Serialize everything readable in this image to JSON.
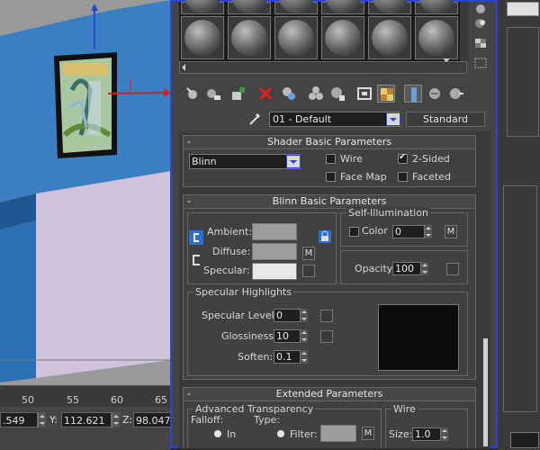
{
  "viewport": {
    "timeline_ticks": [
      "50",
      "55",
      "60",
      "65"
    ],
    "coords": {
      "x_value": ".549",
      "y_label": "Y:",
      "y_value": "112.621",
      "z_label": "Z:",
      "z_value": "98.047"
    }
  },
  "material_editor": {
    "material_name": "01 - Default",
    "material_type": "Standard",
    "shader_basic": {
      "title": "Shader Basic Parameters",
      "shader": "Blinn",
      "wire_label": "Wire",
      "two_sided_label": "2-Sided",
      "face_map_label": "Face Map",
      "faceted_label": "Faceted",
      "two_sided_checked": true
    },
    "blinn_basic": {
      "title": "Blinn Basic Parameters",
      "ambient_label": "Ambient:",
      "diffuse_label": "Diffuse:",
      "specular_label": "Specular:",
      "m_label": "M",
      "self_illum_title": "Self-Illumination",
      "color_label": "Color",
      "self_illum_value": "0",
      "opacity_label": "Opacity:",
      "opacity_value": "100",
      "ambient_color": "#9c9c9c",
      "diffuse_color": "#9c9c9c",
      "specular_color": "#e8e8e8"
    },
    "specular_highlights": {
      "title": "Specular Highlights",
      "level_label": "Specular Level:",
      "level_value": "0",
      "gloss_label": "Glossiness:",
      "gloss_value": "10",
      "soften_label": "Soften:",
      "soften_value": "0.1"
    },
    "extended": {
      "title": "Extended Parameters",
      "adv_transparency_title": "Advanced Transparency",
      "falloff_label": "Falloff:",
      "type_label": "Type:",
      "in_label": "In",
      "filter_label": "Filter:",
      "m_label": "M",
      "wire_title": "Wire",
      "size_label": "Size:",
      "size_value": "1.0"
    }
  },
  "colors": {
    "active_border": "#2a44d8",
    "annotation": "#d0531f"
  }
}
